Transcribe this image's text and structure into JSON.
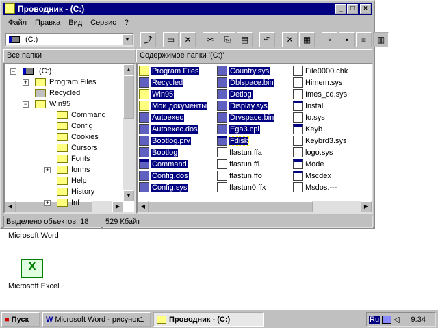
{
  "window": {
    "title": "Проводник -  (C:)",
    "buttons": [
      "_",
      "□",
      "×"
    ]
  },
  "menu": [
    "Файл",
    "Правка",
    "Вид",
    "Сервис",
    "?"
  ],
  "combo": {
    "value": "(C:)"
  },
  "toolbar": [
    "up-folder",
    "map-drive",
    "disconnect",
    "cut",
    "copy",
    "paste",
    "undo",
    "delete",
    "properties",
    "large-icons",
    "small-icons",
    "list",
    "details"
  ],
  "left_header": "Все папки",
  "right_header": "Содержимое папки '(C:)'",
  "tree": [
    {
      "label": "(C:)",
      "level": 0,
      "expander": "−",
      "icon": "drive"
    },
    {
      "label": "Program Files",
      "level": 1,
      "expander": "+",
      "icon": "folder"
    },
    {
      "label": "Recycled",
      "level": 1,
      "expander": "",
      "icon": "recycle"
    },
    {
      "label": "Win95",
      "level": 1,
      "expander": "−",
      "icon": "folder"
    },
    {
      "label": "Command",
      "level": 2,
      "expander": "",
      "icon": "folder"
    },
    {
      "label": "Config",
      "level": 2,
      "expander": "",
      "icon": "folder"
    },
    {
      "label": "Cookies",
      "level": 2,
      "expander": "",
      "icon": "folder"
    },
    {
      "label": "Cursors",
      "level": 2,
      "expander": "",
      "icon": "folder"
    },
    {
      "label": "Fonts",
      "level": 2,
      "expander": "",
      "icon": "folder"
    },
    {
      "label": "forms",
      "level": 2,
      "expander": "+",
      "icon": "folder"
    },
    {
      "label": "Help",
      "level": 2,
      "expander": "",
      "icon": "folder"
    },
    {
      "label": "History",
      "level": 2,
      "expander": "",
      "icon": "folder"
    },
    {
      "label": "Inf",
      "level": 2,
      "expander": "+",
      "icon": "folder"
    }
  ],
  "files": [
    [
      {
        "n": "Program Files",
        "s": 1,
        "i": "folder"
      },
      {
        "n": "Recycled",
        "s": 1,
        "i": "recycle"
      },
      {
        "n": "Win95",
        "s": 1,
        "i": "folder"
      },
      {
        "n": "Мои документы",
        "s": 1,
        "i": "folder"
      },
      {
        "n": "Autoexec",
        "s": 1,
        "i": "file"
      },
      {
        "n": "Autoexec.dos",
        "s": 1,
        "i": "file"
      },
      {
        "n": "Bootlog.prv",
        "s": 1,
        "i": "file"
      },
      {
        "n": "Bootlog",
        "s": 1,
        "i": "file"
      },
      {
        "n": "Command",
        "s": 1,
        "i": "app"
      },
      {
        "n": "Config.dos",
        "s": 1,
        "i": "file"
      },
      {
        "n": "Config.sys",
        "s": 1,
        "i": "file"
      }
    ],
    [
      {
        "n": "Country.sys",
        "s": 1,
        "i": "file"
      },
      {
        "n": "Dblspace.bin",
        "s": 1,
        "i": "file"
      },
      {
        "n": "Detlog",
        "s": 1,
        "i": "file"
      },
      {
        "n": "Display.sys",
        "s": 1,
        "i": "file"
      },
      {
        "n": "Drvspace.bin",
        "s": 1,
        "i": "file"
      },
      {
        "n": "Ega3.cpi",
        "s": 1,
        "i": "file"
      },
      {
        "n": "Fdisk",
        "s": 1,
        "i": "app"
      },
      {
        "n": "ffastun.ffa",
        "s": 0,
        "i": "file"
      },
      {
        "n": "ffastun.ffl",
        "s": 0,
        "i": "file"
      },
      {
        "n": "ffastun.ffo",
        "s": 0,
        "i": "file"
      },
      {
        "n": "ffastun0.ffx",
        "s": 0,
        "i": "file"
      }
    ],
    [
      {
        "n": "File0000.chk",
        "s": 0,
        "i": "file"
      },
      {
        "n": "Himem.sys",
        "s": 0,
        "i": "file"
      },
      {
        "n": "Imes_cd.sys",
        "s": 0,
        "i": "file"
      },
      {
        "n": "Install",
        "s": 0,
        "i": "app"
      },
      {
        "n": "Io.sys",
        "s": 0,
        "i": "file"
      },
      {
        "n": "Keyb",
        "s": 0,
        "i": "app"
      },
      {
        "n": "Keybrd3.sys",
        "s": 0,
        "i": "file"
      },
      {
        "n": "logo.sys",
        "s": 0,
        "i": "file"
      },
      {
        "n": "Mode",
        "s": 0,
        "i": "app"
      },
      {
        "n": "Mscdex",
        "s": 0,
        "i": "app"
      },
      {
        "n": "Msdos.---",
        "s": 0,
        "i": "file"
      }
    ]
  ],
  "status": {
    "selected": "Выделено объектов: 18",
    "size": "529 Кбайт"
  },
  "desktop": {
    "word": "Microsoft Word",
    "excel": "Microsoft Excel"
  },
  "taskbar": {
    "start": "Пуск",
    "task1": "Microsoft Word - рисунок1",
    "task2": "Проводник -  (C:)",
    "lang": "Ru",
    "clock": "9:34"
  }
}
